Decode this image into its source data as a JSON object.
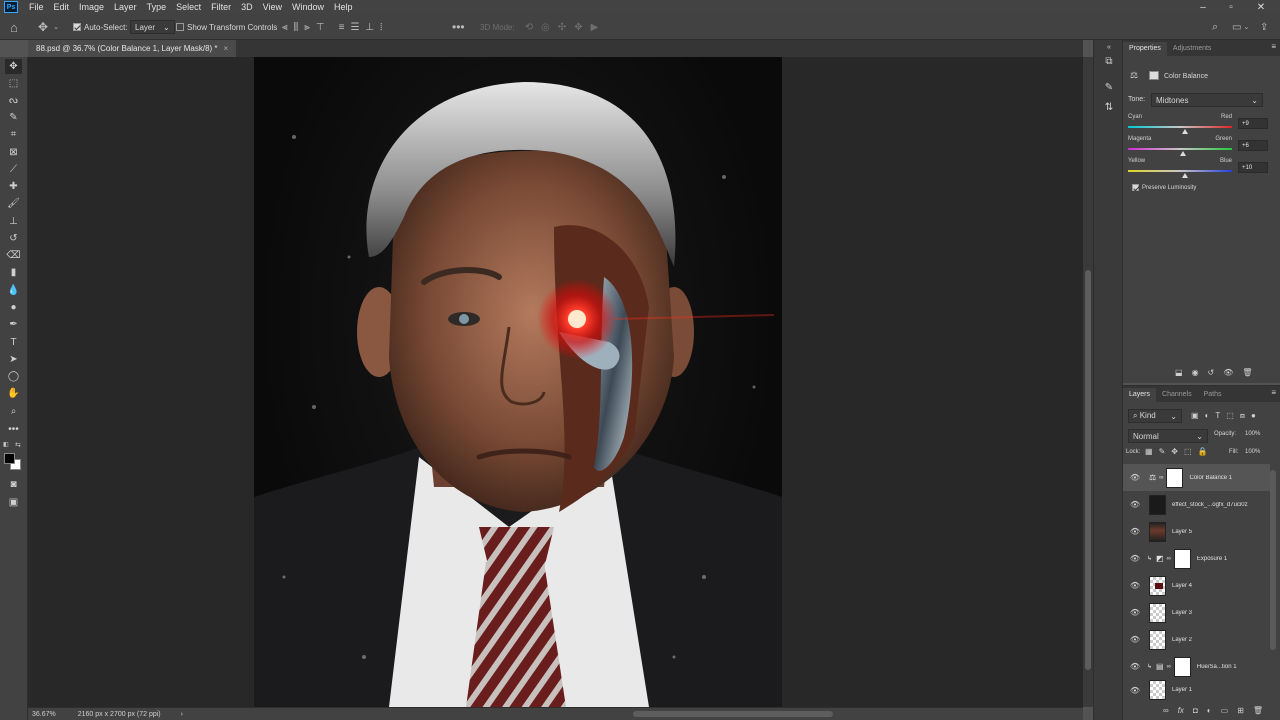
{
  "app": {
    "logo_text": "Ps"
  },
  "menu": [
    "File",
    "Edit",
    "Image",
    "Layer",
    "Type",
    "Select",
    "Filter",
    "3D",
    "View",
    "Window",
    "Help"
  ],
  "options_bar": {
    "auto_select_label": "Auto-Select:",
    "auto_select_target": "Layer",
    "transform_controls_label": "Show Transform Controls",
    "three_d_mode_label": "3D Mode:"
  },
  "document_tab": {
    "title": "88.psd @ 36.7% (Color Balance 1, Layer Mask/8) *",
    "close": "×"
  },
  "status_bar": {
    "zoom": "36.67%",
    "doc_size": "2160 px x 2700 px (72 ppi)",
    "arrow": "›"
  },
  "properties_panel": {
    "tabs": [
      "Properties",
      "Adjustments"
    ],
    "adjustment_name": "Color Balance",
    "tone_label": "Tone:",
    "tone_value": "Midtones",
    "sliders": [
      {
        "left": "Cyan",
        "right": "Red",
        "value": "+9",
        "position": 0.545
      },
      {
        "left": "Magenta",
        "right": "Green",
        "value": "+6",
        "position": 0.53
      },
      {
        "left": "Yellow",
        "right": "Blue",
        "value": "+10",
        "position": 0.55
      }
    ],
    "preserve_luminosity_label": "Preserve Luminosity"
  },
  "layers_panel": {
    "tabs": [
      "Layers",
      "Channels",
      "Paths"
    ],
    "filter_label": "Kind",
    "blend_mode": "Normal",
    "opacity_label": "Opacity:",
    "opacity_value": "100%",
    "lock_label": "Lock:",
    "fill_label": "Fill:",
    "fill_value": "100%",
    "layers": [
      {
        "name": "Color Balance 1",
        "kind": "adjustment",
        "selected": true
      },
      {
        "name": "effect_stock_...ogfx_d7uci0z",
        "kind": "image-dark"
      },
      {
        "name": "Layer 5",
        "kind": "portrait"
      },
      {
        "name": "Exposure 1",
        "kind": "adjustment-clipped"
      },
      {
        "name": "Layer 4",
        "kind": "checker-red"
      },
      {
        "name": "Layer 3",
        "kind": "checker"
      },
      {
        "name": "Layer 2",
        "kind": "checker"
      },
      {
        "name": "Hue/Sa...tion 1",
        "kind": "adjustment-clipped"
      },
      {
        "name": "Layer 1",
        "kind": "checker-portrait"
      }
    ]
  },
  "colors": {
    "accent": "#31a8ff",
    "eye_glow": "#ff1a1a",
    "panel_bg": "#424242",
    "canvas_bg": "#282828"
  }
}
